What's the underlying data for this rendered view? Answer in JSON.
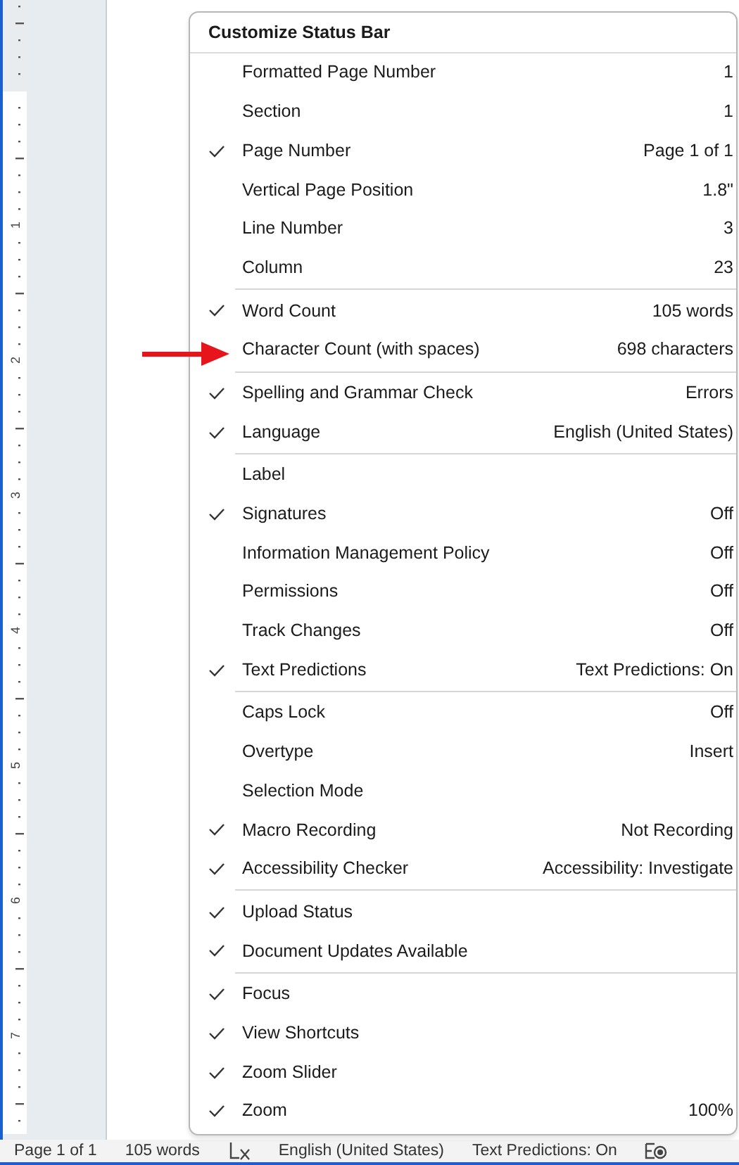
{
  "ruler": {
    "labels": [
      "1",
      "2",
      "3",
      "4",
      "5",
      "6",
      "7"
    ]
  },
  "menu": {
    "title": "Customize Status Bar",
    "groups": [
      [
        {
          "label": "Formatted Page Number",
          "value": "1",
          "checked": false
        },
        {
          "label": "Section",
          "value": "1",
          "checked": false
        },
        {
          "label": "Page Number",
          "value": "Page 1 of 1",
          "checked": true
        },
        {
          "label": "Vertical Page Position",
          "value": "1.8\"",
          "checked": false
        },
        {
          "label": "Line Number",
          "value": "3",
          "checked": false
        },
        {
          "label": "Column",
          "value": "23",
          "checked": false
        }
      ],
      [
        {
          "label": "Word Count",
          "value": "105 words",
          "checked": true
        },
        {
          "label": "Character Count (with spaces)",
          "value": "698 characters",
          "checked": false
        }
      ],
      [
        {
          "label": "Spelling and Grammar Check",
          "value": "Errors",
          "checked": true
        },
        {
          "label": "Language",
          "value": "English (United States)",
          "checked": true
        }
      ],
      [
        {
          "label": "Label",
          "checked": false
        },
        {
          "label": "Signatures",
          "value": "Off",
          "checked": true
        },
        {
          "label": "Information Management Policy",
          "value": "Off",
          "checked": false
        },
        {
          "label": "Permissions",
          "value": "Off",
          "checked": false
        },
        {
          "label": "Track Changes",
          "value": "Off",
          "checked": false
        },
        {
          "label": "Text Predictions",
          "value": "Text Predictions: On",
          "checked": true
        }
      ],
      [
        {
          "label": "Caps Lock",
          "value": "Off",
          "checked": false
        },
        {
          "label": "Overtype",
          "value": "Insert",
          "checked": false
        },
        {
          "label": "Selection Mode",
          "checked": false
        },
        {
          "label": "Macro Recording",
          "value": "Not Recording",
          "checked": true
        },
        {
          "label": "Accessibility Checker",
          "value": "Accessibility: Investigate",
          "checked": true
        }
      ],
      [
        {
          "label": "Upload Status",
          "checked": true
        },
        {
          "label": "Document Updates Available",
          "checked": true
        }
      ],
      [
        {
          "label": "Focus",
          "checked": true
        },
        {
          "label": "View Shortcuts",
          "checked": true
        },
        {
          "label": "Zoom Slider",
          "checked": true
        },
        {
          "label": "Zoom",
          "value": "100%",
          "checked": true
        }
      ]
    ]
  },
  "status_bar": [
    {
      "kind": "text",
      "text": "Page 1 of 1"
    },
    {
      "kind": "text",
      "text": "105 words"
    },
    {
      "kind": "proofing"
    },
    {
      "kind": "text",
      "text": "English (United States)"
    },
    {
      "kind": "text",
      "text": "Text Predictions: On"
    },
    {
      "kind": "focus"
    }
  ]
}
